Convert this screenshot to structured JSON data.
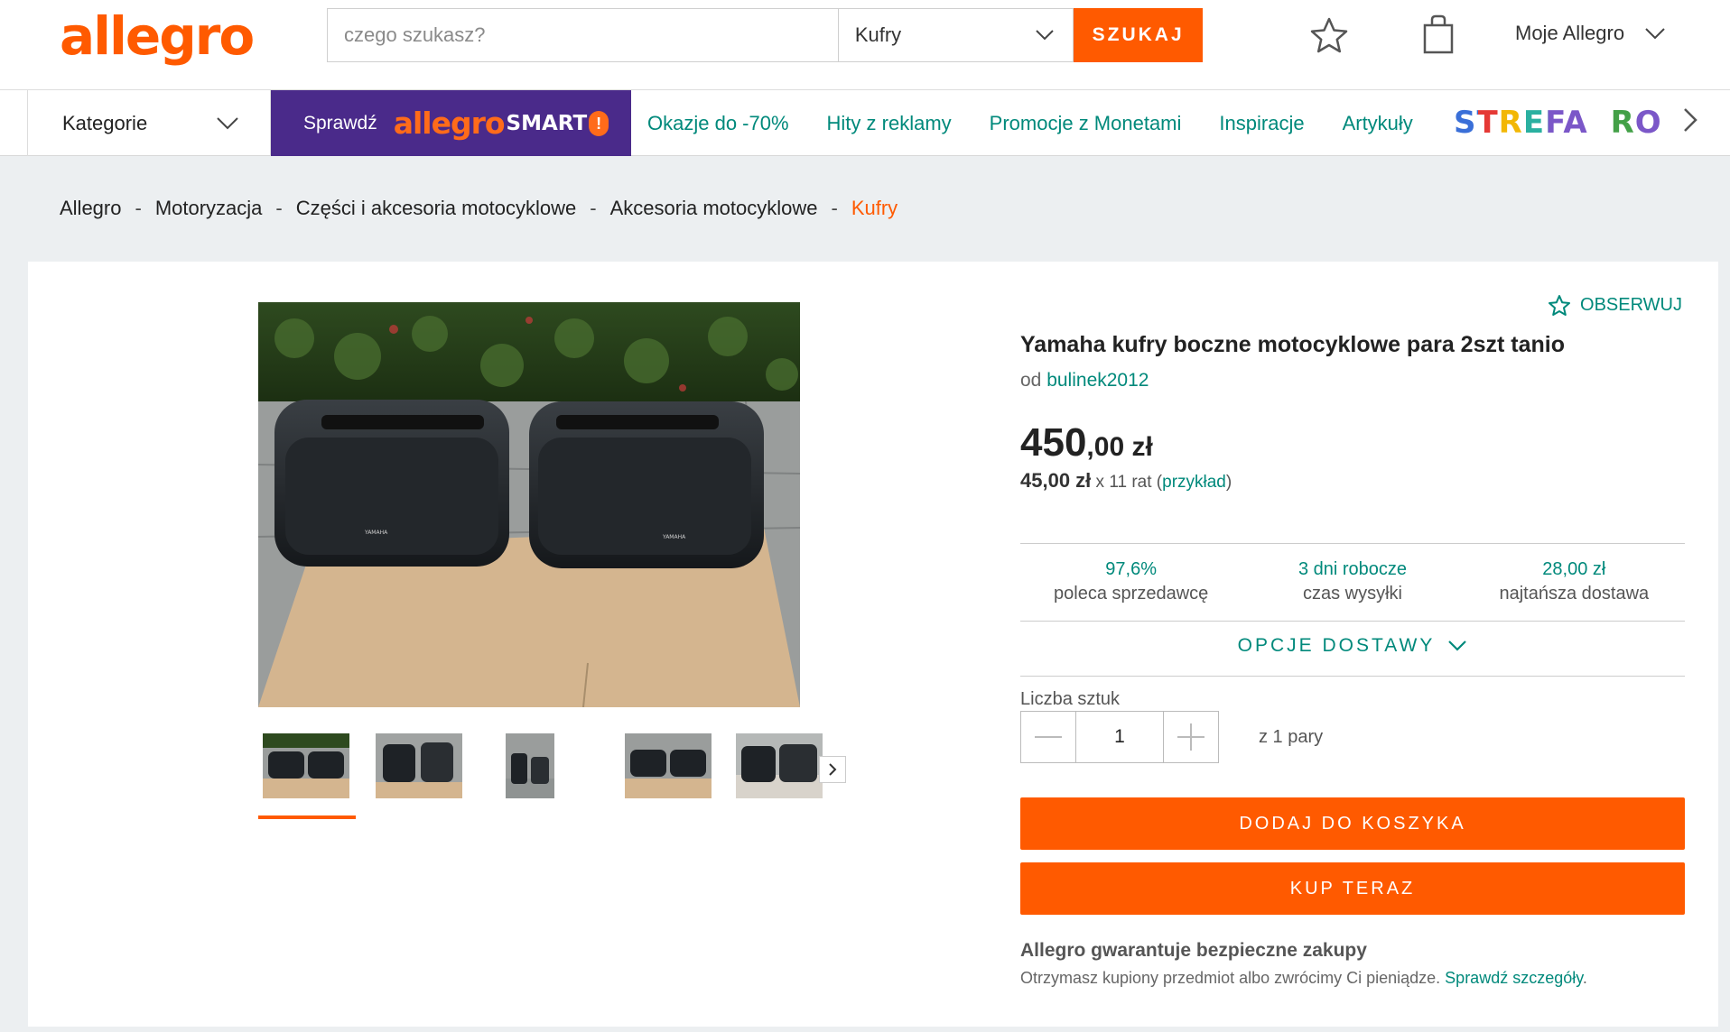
{
  "header": {
    "logo": "allegro",
    "search_placeholder": "czego szukasz?",
    "category": "Kufry",
    "search_button": "SZUKAJ",
    "my_allegro": "Moje Allegro"
  },
  "nav": {
    "categories": "Kategorie",
    "smart_check": "Sprawdź",
    "smart_allegro": "allegro",
    "smart_word": "SMART",
    "smart_badge": "!",
    "links": [
      "Okazje do -70%",
      "Hity z reklamy",
      "Promocje z Monetami",
      "Inspiracje",
      "Artykuły"
    ],
    "strefa": "STREFA",
    "strefa_tail": "RO"
  },
  "breadcrumb": [
    "Allegro",
    "Motoryzacja",
    "Części i akcesoria motocyklowe",
    "Akcesoria motocyklowe",
    "Kufry"
  ],
  "product": {
    "watch": "OBSERWUJ",
    "title": "Yamaha kufry boczne motocyklowe para 2szt tanio",
    "seller_prefix": "od",
    "seller": "bulinek2012",
    "price_main": "450",
    "price_cents": ",00 zł",
    "installment_amount": "45,00 zł",
    "installment_text": " x 11 rat (",
    "installment_link": "przykład",
    "installment_close": ")",
    "brand_badge": "YAMAHA"
  },
  "stats": [
    {
      "value": "97,6%",
      "label": "poleca sprzedawcę"
    },
    {
      "value": "3 dni robocze",
      "label": "czas wysyłki"
    },
    {
      "value": "28,00 zł",
      "label": "najtańsza dostawa"
    }
  ],
  "delivery_options": "OPCJE DOSTAWY",
  "quantity": {
    "label": "Liczba sztuk",
    "value": "1",
    "of_text": "z 1 pary"
  },
  "buttons": {
    "add_to_cart": "DODAJ DO KOSZYKA",
    "buy_now": "KUP TERAZ"
  },
  "guarantee": {
    "title": "Allegro gwarantuje bezpieczne zakupy",
    "text": "Otrzymasz kupiony przedmiot albo zwrócimy Ci pieniądze. ",
    "link": "Sprawdź szczegóły",
    "end": "."
  },
  "colors": {
    "accent": "#ff5a00",
    "teal": "#00897b",
    "smart_purple": "#4a2a8a",
    "background": "#eceff1"
  },
  "icons": [
    "star-icon",
    "shopping-bag-icon",
    "chevron-down-icon",
    "chevron-right-icon",
    "minus-icon",
    "plus-icon",
    "star-outline-icon"
  ]
}
